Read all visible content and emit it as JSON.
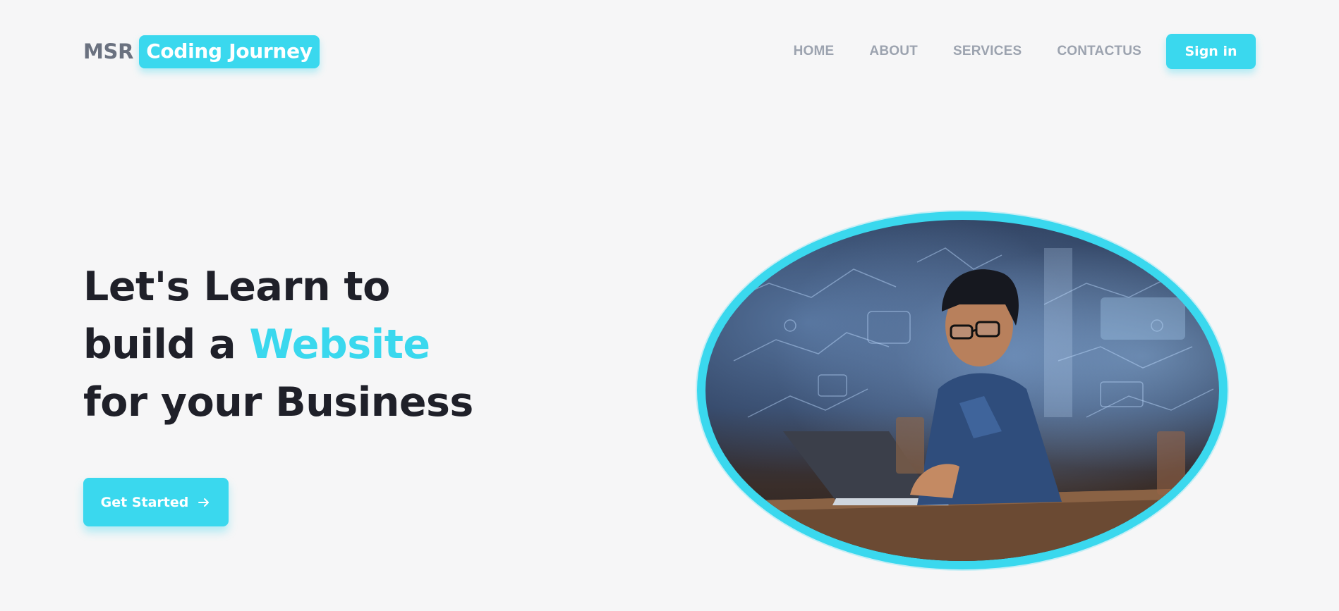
{
  "header": {
    "logo_prefix": "MSR",
    "logo_badge": "Coding Journey",
    "nav": [
      "HOME",
      "ABOUT",
      "SERVICES",
      "CONTACTUS"
    ],
    "signin_label": "Sign in"
  },
  "hero": {
    "line1": "Let's Learn to",
    "line2_prefix": "build a ",
    "line2_accent": "Website",
    "line3": "for your Business",
    "cta_label": "Get Started",
    "cta_icon": "arrow-right-icon",
    "image_subject": "boy-coding-on-laptop"
  },
  "colors": {
    "accent": "#3ad8ee",
    "background": "#f6f6f7",
    "heading": "#1f2029",
    "nav_text": "#9ca3af",
    "logo_text": "#6b7280"
  }
}
